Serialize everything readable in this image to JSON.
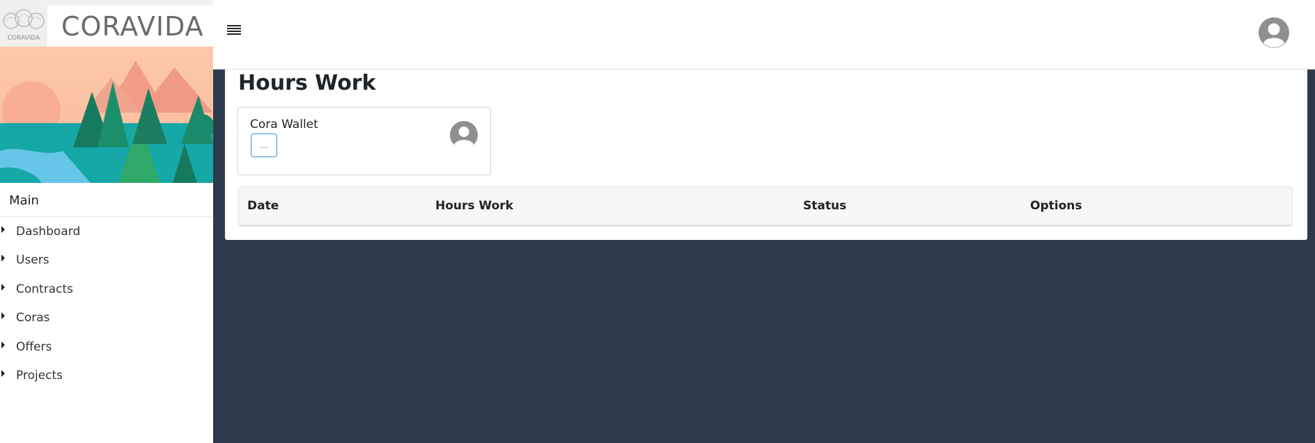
{
  "brand": {
    "name": "CORAVIDA",
    "logo_text": "CORAVIDA"
  },
  "sidebar": {
    "section_title": "Main",
    "items": [
      {
        "label": "Dashboard"
      },
      {
        "label": "Users"
      },
      {
        "label": "Contracts"
      },
      {
        "label": "Coras"
      },
      {
        "label": "Offers"
      },
      {
        "label": "Projects"
      }
    ]
  },
  "header": {
    "menu_icon": "hamburger-icon",
    "user_icon": "user-avatar-icon"
  },
  "main": {
    "title": "Hours Work",
    "wallet": {
      "title": "Cora Wallet",
      "button_label": "...",
      "avatar_icon": "user-avatar-icon"
    },
    "table": {
      "columns": [
        "Date",
        "Hours Work",
        "Status",
        "Options"
      ],
      "rows": []
    }
  },
  "colors": {
    "sidebar_bg": "#ffffff",
    "page_bg": "#2d3c4d",
    "card_bg": "#ffffff",
    "button_border": "#3d8fd6",
    "table_header_bg": "#f6f7f8"
  }
}
